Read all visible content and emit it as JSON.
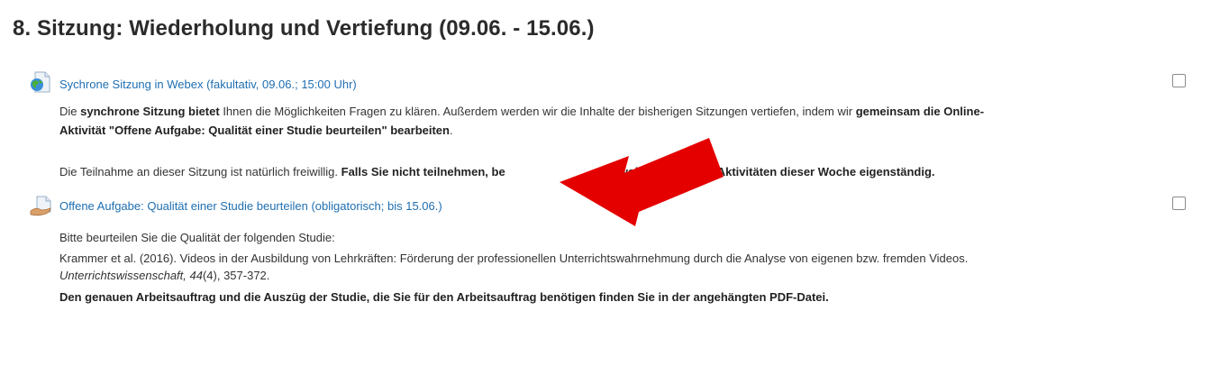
{
  "section": {
    "title": "8. Sitzung: Wiederholung und Vertiefung (09.06. - 15.06.)"
  },
  "activity1": {
    "link": "Sychrone Sitzung in Webex (fakultativ, 09.06.; 15:00 Uhr)",
    "icon": "webex-globe-icon",
    "desc1": {
      "p1": "Die ",
      "b1": "synchrone Sitzung bietet",
      "p2": " Ihnen die Möglichkeiten Fragen zu klären. Außerdem werden wir die Inhalte der bisherigen Sitzungen vertiefen, indem wir ",
      "b2": "gemeinsam die Online-"
    },
    "desc2": {
      "b1": "Aktivität \"Offene Aufgabe: Qualität einer Studie beurteilen\" bearbeiten",
      "p1": "."
    },
    "desc3": {
      "p1": "Die Teilnahme an dieser Sitzung ist natürlich freiwillig. ",
      "b1": "Falls Sie nicht teilnehmen, be",
      "b2": "wohnt die Online-Aktivitäten dieser Woche eigenständig."
    }
  },
  "activity2": {
    "link": "Offene Aufgabe: Qualität einer Studie beurteilen (obligatorisch; bis 15.06.)",
    "icon": "assignment-hand-icon",
    "desc1": "Bitte beurteilen Sie die Qualität der folgenden Studie:",
    "citation": {
      "line1": "Krammer et al. (2016). Videos in der Ausbildung von Lehrkräften: Förderung der professionellen Unterrichtswahrnehmung durch die Analyse von eigenen bzw. fremden Videos.",
      "journal": "Unterrichtswissenschaft, 44",
      "rest": "(4), 357-372."
    },
    "instruction": "Den genauen Arbeitsauftrag und die Auszüg der Studie, die Sie für den Arbeitsauftrag benötigen finden Sie in der angehängten PDF-Datei."
  },
  "colors": {
    "link": "#1f6fb2",
    "arrow": "#e50000",
    "text": "#333333"
  }
}
